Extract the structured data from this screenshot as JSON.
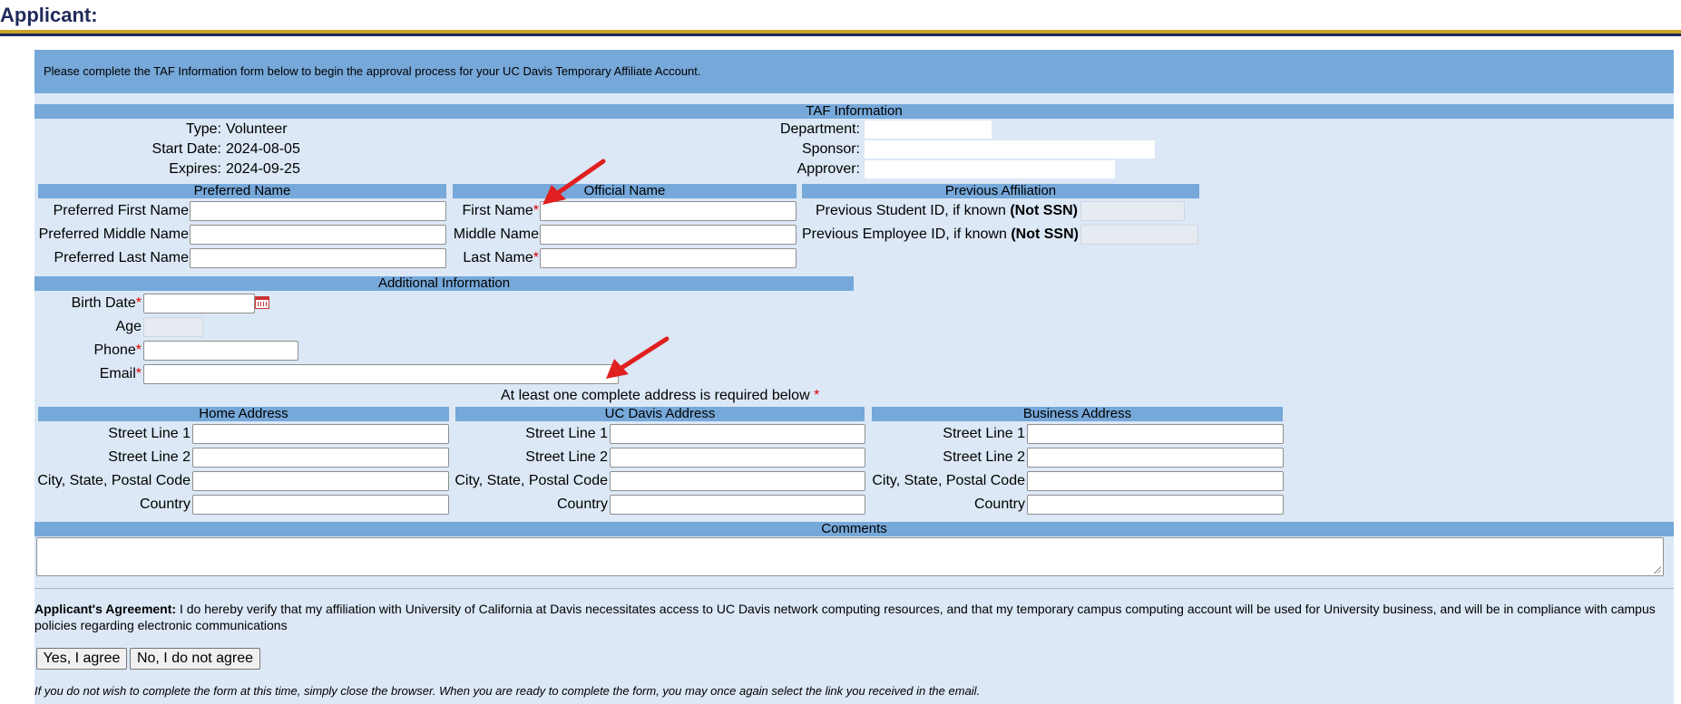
{
  "page": {
    "title": "Applicant:"
  },
  "intro_text": "Please complete the TAF Information form below to begin the approval process for your UC Davis Temporary Affiliate Account.",
  "taf": {
    "header": "TAF Information",
    "type_label": "Type:",
    "type_value": "Volunteer",
    "start_label": "Start Date:",
    "start_value": "2024-08-05",
    "expires_label": "Expires:",
    "expires_value": "2024-09-25",
    "department_label": "Department:",
    "sponsor_label": "Sponsor:",
    "approver_label": "Approver:"
  },
  "preferred": {
    "header": "Preferred Name",
    "first_label": "Preferred First Name",
    "middle_label": "Preferred Middle Name",
    "last_label": "Preferred Last Name"
  },
  "official": {
    "header": "Official Name",
    "first_label": "First Name",
    "middle_label": "Middle Name",
    "last_label": "Last Name"
  },
  "previous": {
    "header": "Previous Affiliation",
    "student_label": "Previous Student ID, if known",
    "employee_label": "Previous Employee ID, if known",
    "not_ssn": "(Not SSN)"
  },
  "additional": {
    "header": "Additional Information",
    "birth_label": "Birth Date",
    "age_label": "Age",
    "phone_label": "Phone",
    "email_label": "Email"
  },
  "address_note": "At least one complete address is required below",
  "required_mark": "*",
  "addresses": {
    "home": {
      "header": "Home Address"
    },
    "ucd": {
      "header": "UC Davis Address"
    },
    "business": {
      "header": "Business Address"
    },
    "street1": "Street Line 1",
    "street2": "Street Line 2",
    "city": "City, State, Postal Code",
    "country": "Country"
  },
  "comments_header": "Comments",
  "agreement": {
    "title": "Applicant's Agreement:",
    "text": " I do hereby verify that my affiliation with University of California at Davis necessitates access to UC Davis network computing resources, and that my temporary campus computing account will be used for University business, and will be in compliance with campus policies regarding electronic communications",
    "yes_button": "Yes, I agree",
    "no_button": "No, I do not agree"
  },
  "footer_note": "If you do not wish to complete the form at this time, simply close the browser. When you are ready to complete the form, you may once again select the link you received in the email.",
  "colors": {
    "header_bar": "#76a8d9",
    "panel": "#dce8f6",
    "title": "#1f2a5a",
    "gold_rule": "#c9a227",
    "arrow": "#e02020",
    "required": "#dd0000"
  },
  "icons": [
    "calendar-icon",
    "annotation-arrow"
  ]
}
